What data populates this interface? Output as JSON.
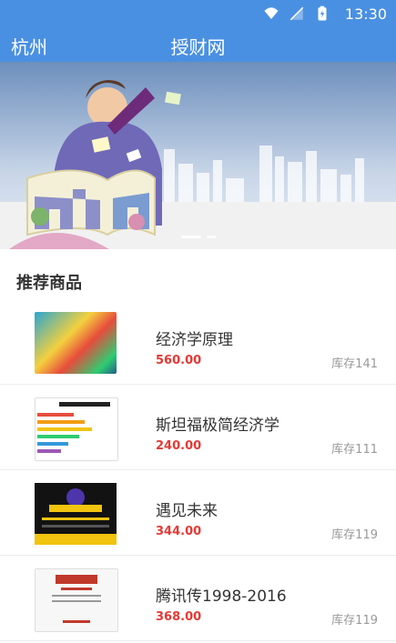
{
  "status": {
    "time": "13:30"
  },
  "appbar": {
    "city": "杭州",
    "title": "授财网"
  },
  "section": {
    "title": "推荐商品"
  },
  "products": [
    {
      "name": "经济学原理",
      "price": "560.00",
      "stock": "库存141"
    },
    {
      "name": "斯坦福极简经济学",
      "price": "240.00",
      "stock": "库存111"
    },
    {
      "name": "遇见未来",
      "price": "344.00",
      "stock": "库存119"
    },
    {
      "name": "腾讯传1998-2016",
      "price": "368.00",
      "stock": "库存119"
    }
  ],
  "colors": {
    "primary": "#4a90e2",
    "price": "#e53935",
    "stock": "#999999"
  },
  "icons": [
    "wifi-icon",
    "signal-icon",
    "battery-icon"
  ]
}
